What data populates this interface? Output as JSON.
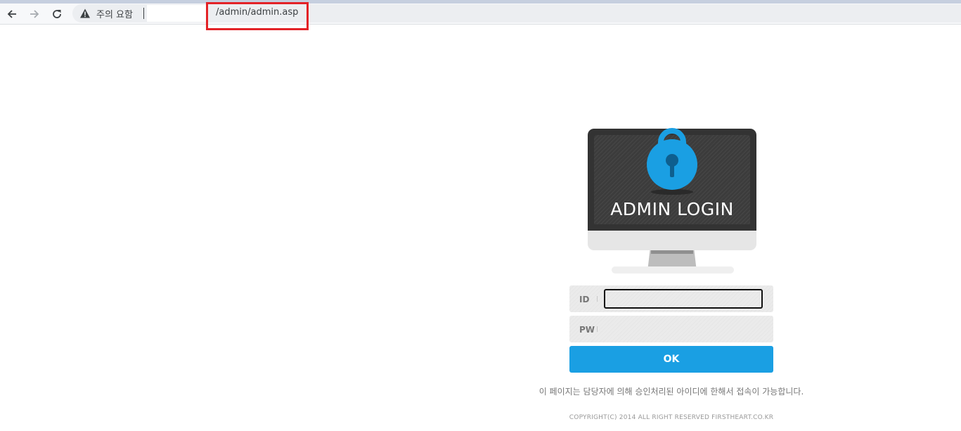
{
  "browser": {
    "security_warning": "주의 요함",
    "url_path": "/admin/admin.asp"
  },
  "login": {
    "title": "ADMIN LOGIN",
    "id_label": "ID",
    "pw_label": "PW",
    "ok_label": "OK",
    "notice": "이 페이지는 담당자에 의해 승인처리된 아이디에 한해서 접속이 가능합니다.",
    "copyright": "COPYRIGHT(C) 2014 ALL RIGHT RESERVED FIRSTHEART.CO.KR"
  },
  "colors": {
    "accent": "#1a9fe3",
    "highlight_box": "#e32227",
    "monitor_frame": "#333333"
  }
}
